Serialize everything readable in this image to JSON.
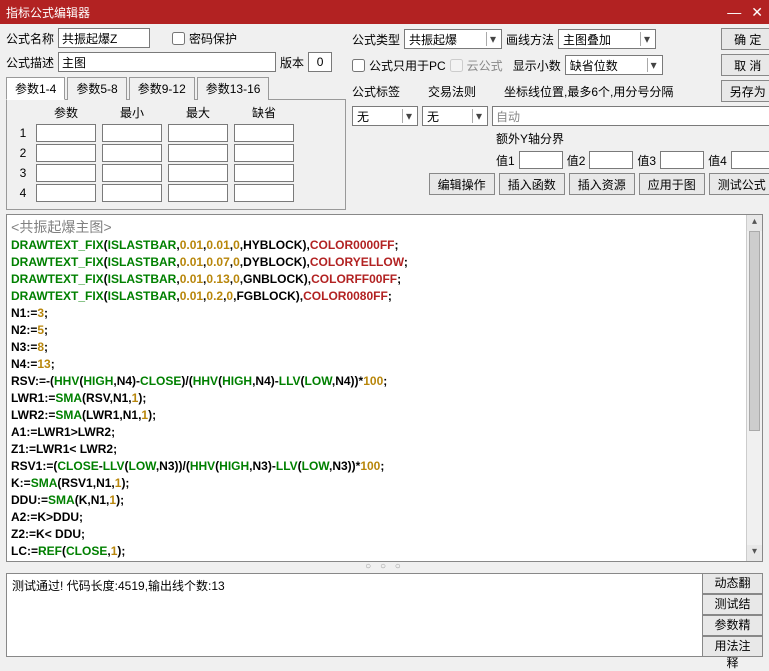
{
  "window": {
    "title": "指标公式编辑器"
  },
  "labels": {
    "formula_name": "公式名称",
    "pwd_protect": "密码保护",
    "formula_desc": "公式描述",
    "version": "版本",
    "formula_type": "公式类型",
    "draw_method": "画线方法",
    "pc_only": "公式只用于PC",
    "cloud_formula": "云公式",
    "show_decimal": "显示小数",
    "formula_tag": "公式标签",
    "trade_rule": "交易法则",
    "coord_hint": "坐标线位置,最多6个,用分号分隔",
    "extra_y": "额外Y轴分界",
    "v1": "值1",
    "v2": "值2",
    "v3": "值3",
    "v4": "值4"
  },
  "fields": {
    "name": "共振起爆Z",
    "desc": "主图",
    "version": "0",
    "type": "共振起爆",
    "draw": "主图叠加",
    "decimal": "缺省位数",
    "tag": "无",
    "rule": "无",
    "coord": "自动",
    "y1": "",
    "y2": "",
    "y3": "",
    "y4": ""
  },
  "buttons": {
    "ok": "确 定",
    "cancel": "取 消",
    "save_as": "另存为",
    "edit_op": "编辑操作",
    "insert_fn": "插入函数",
    "insert_res": "插入资源",
    "apply": "应用于图",
    "test": "测试公式",
    "dyn_trans": "动态翻译",
    "test_result": "测试结果",
    "param_wiz": "参数精灵",
    "usage": "用法注释"
  },
  "tabs": {
    "t1": "参数1-4",
    "t2": "参数5-8",
    "t3": "参数9-12",
    "t4": "参数13-16"
  },
  "param_headers": {
    "name": "参数",
    "min": "最小",
    "max": "最大",
    "def": "缺省"
  },
  "param_rows": [
    "1",
    "2",
    "3",
    "4"
  ],
  "code_title": "<共振起爆主图>",
  "code_lines": [
    [
      [
        "fn",
        "DRAWTEXT_FIX"
      ],
      [
        "op",
        "("
      ],
      [
        "fn",
        "ISLASTBAR"
      ],
      [
        "op",
        ","
      ],
      [
        "num",
        "0.01"
      ],
      [
        "op",
        ","
      ],
      [
        "num",
        "0.01"
      ],
      [
        "op",
        ","
      ],
      [
        "num",
        "0"
      ],
      [
        "op",
        ","
      ],
      [
        "var",
        "HYBLOCK"
      ],
      [
        "op",
        ")"
      ],
      [
        "op",
        ","
      ],
      [
        "color",
        "COLOR0000FF"
      ],
      [
        "op",
        ";"
      ]
    ],
    [
      [
        "fn",
        "DRAWTEXT_FIX"
      ],
      [
        "op",
        "("
      ],
      [
        "fn",
        "ISLASTBAR"
      ],
      [
        "op",
        ","
      ],
      [
        "num",
        "0.01"
      ],
      [
        "op",
        ","
      ],
      [
        "num",
        "0.07"
      ],
      [
        "op",
        ","
      ],
      [
        "num",
        "0"
      ],
      [
        "op",
        ","
      ],
      [
        "var",
        "DYBLOCK"
      ],
      [
        "op",
        ")"
      ],
      [
        "op",
        ","
      ],
      [
        "color",
        "COLORYELLOW"
      ],
      [
        "op",
        ";"
      ]
    ],
    [
      [
        "fn",
        "DRAWTEXT_FIX"
      ],
      [
        "op",
        "("
      ],
      [
        "fn",
        "ISLASTBAR"
      ],
      [
        "op",
        ","
      ],
      [
        "num",
        "0.01"
      ],
      [
        "op",
        ","
      ],
      [
        "num",
        "0.13"
      ],
      [
        "op",
        ","
      ],
      [
        "num",
        "0"
      ],
      [
        "op",
        ","
      ],
      [
        "var",
        "GNBLOCK"
      ],
      [
        "op",
        ")"
      ],
      [
        "op",
        ","
      ],
      [
        "color",
        "COLORFF00FF"
      ],
      [
        "op",
        ";"
      ]
    ],
    [
      [
        "fn",
        "DRAWTEXT_FIX"
      ],
      [
        "op",
        "("
      ],
      [
        "fn",
        "ISLASTBAR"
      ],
      [
        "op",
        ","
      ],
      [
        "num",
        "0.01"
      ],
      [
        "op",
        ","
      ],
      [
        "num",
        "0.2"
      ],
      [
        "op",
        ","
      ],
      [
        "num",
        "0"
      ],
      [
        "op",
        ","
      ],
      [
        "var",
        "FGBLOCK"
      ],
      [
        "op",
        ")"
      ],
      [
        "op",
        ","
      ],
      [
        "color",
        "COLOR0080FF"
      ],
      [
        "op",
        ";"
      ]
    ],
    [
      [
        "var",
        "N1"
      ],
      [
        "op",
        ":="
      ],
      [
        "num",
        "3"
      ],
      [
        "op",
        ";"
      ]
    ],
    [
      [
        "var",
        "N2"
      ],
      [
        "op",
        ":="
      ],
      [
        "num",
        "5"
      ],
      [
        "op",
        ";"
      ]
    ],
    [
      [
        "var",
        "N3"
      ],
      [
        "op",
        ":="
      ],
      [
        "num",
        "8"
      ],
      [
        "op",
        ";"
      ]
    ],
    [
      [
        "var",
        "N4"
      ],
      [
        "op",
        ":="
      ],
      [
        "num",
        "13"
      ],
      [
        "op",
        ";"
      ]
    ],
    [
      [
        "var",
        "RSV"
      ],
      [
        "op",
        ":=-("
      ],
      [
        "fn",
        "HHV"
      ],
      [
        "op",
        "("
      ],
      [
        "fn",
        "HIGH"
      ],
      [
        "op",
        ","
      ],
      [
        "var",
        "N4"
      ],
      [
        "op",
        ")-"
      ],
      [
        "fn",
        "CLOSE"
      ],
      [
        "op",
        ")/("
      ],
      [
        "fn",
        "HHV"
      ],
      [
        "op",
        "("
      ],
      [
        "fn",
        "HIGH"
      ],
      [
        "op",
        ","
      ],
      [
        "var",
        "N4"
      ],
      [
        "op",
        ")-"
      ],
      [
        "fn",
        "LLV"
      ],
      [
        "op",
        "("
      ],
      [
        "fn",
        "LOW"
      ],
      [
        "op",
        ","
      ],
      [
        "var",
        "N4"
      ],
      [
        "op",
        "))*"
      ],
      [
        "num",
        "100"
      ],
      [
        "op",
        ";"
      ]
    ],
    [
      [
        "var",
        "LWR1"
      ],
      [
        "op",
        ":="
      ],
      [
        "fn",
        "SMA"
      ],
      [
        "op",
        "("
      ],
      [
        "var",
        "RSV"
      ],
      [
        "op",
        ","
      ],
      [
        "var",
        "N1"
      ],
      [
        "op",
        ","
      ],
      [
        "num",
        "1"
      ],
      [
        "op",
        ");"
      ]
    ],
    [
      [
        "var",
        "LWR2"
      ],
      [
        "op",
        ":="
      ],
      [
        "fn",
        "SMA"
      ],
      [
        "op",
        "("
      ],
      [
        "var",
        "LWR1"
      ],
      [
        "op",
        ","
      ],
      [
        "var",
        "N1"
      ],
      [
        "op",
        ","
      ],
      [
        "num",
        "1"
      ],
      [
        "op",
        ");"
      ]
    ],
    [
      [
        "var",
        "A1"
      ],
      [
        "op",
        ":="
      ],
      [
        "var",
        "LWR1"
      ],
      [
        "op",
        ">"
      ],
      [
        "var",
        "LWR2"
      ],
      [
        "op",
        ";"
      ]
    ],
    [
      [
        "var",
        "Z1"
      ],
      [
        "op",
        ":="
      ],
      [
        "var",
        "LWR1"
      ],
      [
        "op",
        "< "
      ],
      [
        "var",
        "LWR2"
      ],
      [
        "op",
        ";"
      ]
    ],
    [
      [
        "var",
        "RSV1"
      ],
      [
        "op",
        ":=("
      ],
      [
        "fn",
        "CLOSE"
      ],
      [
        "op",
        "-"
      ],
      [
        "fn",
        "LLV"
      ],
      [
        "op",
        "("
      ],
      [
        "fn",
        "LOW"
      ],
      [
        "op",
        ","
      ],
      [
        "var",
        "N3"
      ],
      [
        "op",
        "))/("
      ],
      [
        "fn",
        "HHV"
      ],
      [
        "op",
        "("
      ],
      [
        "fn",
        "HIGH"
      ],
      [
        "op",
        ","
      ],
      [
        "var",
        "N3"
      ],
      [
        "op",
        ")-"
      ],
      [
        "fn",
        "LLV"
      ],
      [
        "op",
        "("
      ],
      [
        "fn",
        "LOW"
      ],
      [
        "op",
        ","
      ],
      [
        "var",
        "N3"
      ],
      [
        "op",
        "))*"
      ],
      [
        "num",
        "100"
      ],
      [
        "op",
        ";"
      ]
    ],
    [
      [
        "var",
        "K"
      ],
      [
        "op",
        ":="
      ],
      [
        "fn",
        "SMA"
      ],
      [
        "op",
        "("
      ],
      [
        "var",
        "RSV1"
      ],
      [
        "op",
        ","
      ],
      [
        "var",
        "N1"
      ],
      [
        "op",
        ","
      ],
      [
        "num",
        "1"
      ],
      [
        "op",
        ");"
      ]
    ],
    [
      [
        "var",
        "DDU"
      ],
      [
        "op",
        ":="
      ],
      [
        "fn",
        "SMA"
      ],
      [
        "op",
        "("
      ],
      [
        "var",
        "K"
      ],
      [
        "op",
        ","
      ],
      [
        "var",
        "N1"
      ],
      [
        "op",
        ","
      ],
      [
        "num",
        "1"
      ],
      [
        "op",
        ");"
      ]
    ],
    [
      [
        "var",
        "A2"
      ],
      [
        "op",
        ":="
      ],
      [
        "var",
        "K"
      ],
      [
        "op",
        ">"
      ],
      [
        "var",
        "DDU"
      ],
      [
        "op",
        ";"
      ]
    ],
    [
      [
        "var",
        "Z2"
      ],
      [
        "op",
        ":="
      ],
      [
        "var",
        "K"
      ],
      [
        "op",
        "< "
      ],
      [
        "var",
        "DDU"
      ],
      [
        "op",
        ";"
      ]
    ],
    [
      [
        "var",
        "LC"
      ],
      [
        "op",
        ":="
      ],
      [
        "fn",
        "REF"
      ],
      [
        "op",
        "("
      ],
      [
        "fn",
        "CLOSE"
      ],
      [
        "op",
        ","
      ],
      [
        "num",
        "1"
      ],
      [
        "op",
        ");"
      ]
    ]
  ],
  "result_text": "测试通过! 代码长度:4519,输出线个数:13"
}
